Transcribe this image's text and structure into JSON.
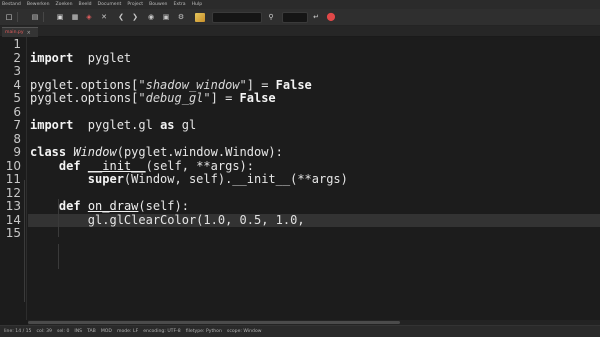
{
  "menu": [
    "Bestand",
    "Bewerken",
    "Zoeken",
    "Beeld",
    "Document",
    "Project",
    "Bouwen",
    "Extra",
    "Hulp"
  ],
  "toolbar": {
    "new_icon": "new-file-icon",
    "open_icon": "open-file-icon",
    "save_icon": "save-icon",
    "save_all_icon": "save-all-icon",
    "revert_icon": "revert-icon",
    "close_icon": "close-icon",
    "back_icon": "navigate-back-icon",
    "forward_icon": "navigate-forward-icon",
    "compile_icon": "compile-icon",
    "run_icon": "run-icon",
    "color_icon": "color-chooser-icon",
    "search_icon": "search-icon",
    "goto_icon": "goto-line-icon",
    "quit_icon": "quit-icon",
    "quit_color": "#e04848",
    "search_value": "",
    "goto_value": ""
  },
  "tabs": [
    {
      "label": "main.py",
      "close": "×",
      "modified_color": "#e25c5c"
    }
  ],
  "editor": {
    "current_line": 14,
    "lines": [
      {
        "n": "1",
        "segs": []
      },
      {
        "n": "2",
        "segs": [
          [
            "kw",
            "import"
          ],
          [
            "",
            "  pyglet"
          ]
        ]
      },
      {
        "n": "3",
        "segs": []
      },
      {
        "n": "4",
        "segs": [
          [
            "",
            "pyglet.options["
          ],
          [
            "str",
            "\"shadow_window\""
          ],
          [
            "",
            "] = "
          ],
          [
            "kc",
            "False"
          ]
        ]
      },
      {
        "n": "5",
        "segs": [
          [
            "",
            "pyglet.options["
          ],
          [
            "str",
            "\"debug_gl\""
          ],
          [
            "",
            "] = "
          ],
          [
            "kc",
            "False"
          ]
        ]
      },
      {
        "n": "6",
        "segs": []
      },
      {
        "n": "7",
        "segs": [
          [
            "kw",
            "import"
          ],
          [
            "",
            "  pyglet.gl "
          ],
          [
            "kw",
            "as"
          ],
          [
            "",
            " gl"
          ]
        ]
      },
      {
        "n": "8",
        "segs": []
      },
      {
        "n": "9",
        "segs": [
          [
            "kw",
            "class"
          ],
          [
            "",
            " "
          ],
          [
            "cls",
            "Window"
          ],
          [
            "",
            "(pyglet.window.Window):"
          ]
        ]
      },
      {
        "n": "10",
        "segs": [
          [
            "",
            "    "
          ],
          [
            "kw",
            "def"
          ],
          [
            "",
            " "
          ],
          [
            "fn",
            "__init__"
          ],
          [
            "",
            "(self, **args):"
          ]
        ]
      },
      {
        "n": "11",
        "segs": [
          [
            "",
            "        "
          ],
          [
            "kw",
            "super"
          ],
          [
            "",
            "(Window, self).__init__(**args)"
          ]
        ]
      },
      {
        "n": "12",
        "segs": []
      },
      {
        "n": "13",
        "segs": [
          [
            "",
            "    "
          ],
          [
            "kw",
            "def"
          ],
          [
            "",
            " "
          ],
          [
            "fn",
            "on_draw"
          ],
          [
            "",
            "(self):"
          ]
        ]
      },
      {
        "n": "14",
        "segs": [
          [
            "",
            "        gl.glClearColor("
          ],
          [
            "num",
            "1.0"
          ],
          [
            "",
            ", "
          ],
          [
            "num",
            "0.5"
          ],
          [
            "",
            ", "
          ],
          [
            "num",
            "1.0"
          ],
          [
            "",
            ","
          ]
        ]
      },
      {
        "n": "15",
        "segs": []
      }
    ]
  },
  "status": [
    "line: 14 / 15",
    "col: 39",
    "sel: 0",
    "INS",
    "TAB",
    "MOD",
    "mode: LF",
    "encoding: UTF-8",
    "filetype: Python",
    "scope: Window"
  ],
  "colors": {
    "background": "#1c1c1c",
    "current_line": "#333333",
    "accent_red": "#e25c5c"
  }
}
